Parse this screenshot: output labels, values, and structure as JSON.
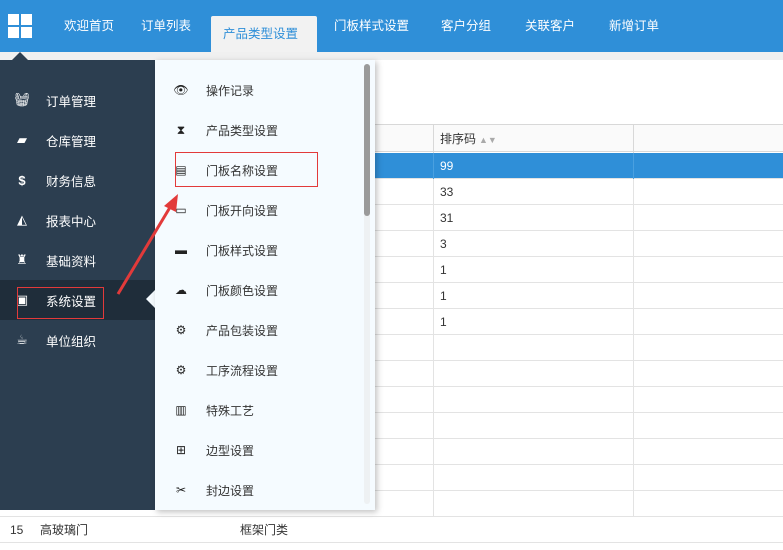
{
  "tabs": [
    {
      "label": "欢迎首页"
    },
    {
      "label": "订单列表"
    },
    {
      "label": "产品类型设置",
      "close": "×"
    },
    {
      "label": "门板样式设置"
    },
    {
      "label": "客户分组"
    },
    {
      "label": "关联客户"
    },
    {
      "label": "新增订单"
    }
  ],
  "sidebar": {
    "items": [
      {
        "label": "订单管理",
        "icon": "basket-icon"
      },
      {
        "label": "仓库管理",
        "icon": "note-icon"
      },
      {
        "label": "财务信息",
        "icon": "dollar-icon"
      },
      {
        "label": "报表中心",
        "icon": "area-chart-icon"
      },
      {
        "label": "基础资料",
        "icon": "sitemap-icon"
      },
      {
        "label": "系统设置",
        "icon": "bag-icon"
      },
      {
        "label": "单位组织",
        "icon": "cup-icon"
      }
    ]
  },
  "submenu": {
    "items": [
      {
        "label": "操作记录",
        "icon": "eye-icon"
      },
      {
        "label": "产品类型设置",
        "icon": "hourglass-icon"
      },
      {
        "label": "门板名称设置",
        "icon": "film-icon"
      },
      {
        "label": "门板开向设置",
        "icon": "door-icon"
      },
      {
        "label": "门板样式设置",
        "icon": "box-icon"
      },
      {
        "label": "门板颜色设置",
        "icon": "cloud-icon"
      },
      {
        "label": "产品包装设置",
        "icon": "gear-icon"
      },
      {
        "label": "工序流程设置",
        "icon": "gear-icon"
      },
      {
        "label": "特殊工艺",
        "icon": "map-icon"
      },
      {
        "label": "边型设置",
        "icon": "network-icon"
      },
      {
        "label": "封边设置",
        "icon": "scissors-icon"
      }
    ]
  },
  "table": {
    "header_sort": "排序码",
    "rows": [
      {
        "sort": "99"
      },
      {
        "sort": "33"
      },
      {
        "sort": "31"
      },
      {
        "sort": "3"
      },
      {
        "sort": "1"
      },
      {
        "sort": "1"
      },
      {
        "sort": "1"
      }
    ],
    "bottom_row": {
      "idx": "15",
      "name": "高玻璃门",
      "type": "框架门类"
    }
  },
  "colors": {
    "topbar": "#2f8fd8",
    "sidebar": "#2c3e50",
    "selected_row": "#2f8fd8",
    "annotation": "#e23a3a"
  }
}
